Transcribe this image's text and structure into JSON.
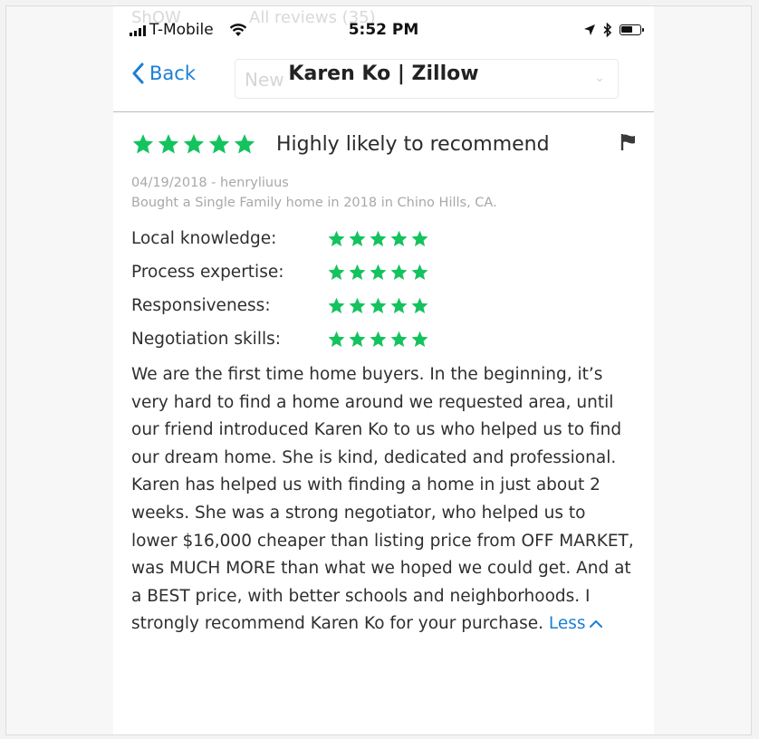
{
  "ghost": {
    "top_left": "ShOW",
    "top_mid": "All reviews (35)",
    "select_value": "New"
  },
  "status_bar": {
    "carrier": "T-Mobile",
    "time": "5:52 PM"
  },
  "nav": {
    "back_label": "Back",
    "title": "Karen Ko | Zillow"
  },
  "review": {
    "overall_rating": 5,
    "headline": "Highly likely to recommend",
    "date_author": "04/19/2018 - henryliuus",
    "transaction": "Bought a Single Family home in 2018 in Chino Hills, CA.",
    "sub_ratings": [
      {
        "label": "Local knowledge:",
        "rating": 5
      },
      {
        "label": "Process expertise:",
        "rating": 5
      },
      {
        "label": "Responsiveness:",
        "rating": 5
      },
      {
        "label": "Negotiation skills:",
        "rating": 5
      }
    ],
    "text": "We are the first time home buyers. In the beginning, it’s very hard to find a home around we requested area, until our friend introduced Karen Ko to us who helped us to find our dream home. She is kind, dedicated and professional. Karen has helped us with finding a home in just about 2 weeks. She was a strong negotiator, who helped us to lower $16,000 cheaper than listing price from OFF MARKET, was MUCH MORE than what we hoped we could get. And at a BEST price, with better schools and neighborhoods. I strongly recommend Karen Ko for your purchase.",
    "less_label": "Less"
  },
  "colors": {
    "star": "#14c35e",
    "link": "#1a7fd6"
  }
}
